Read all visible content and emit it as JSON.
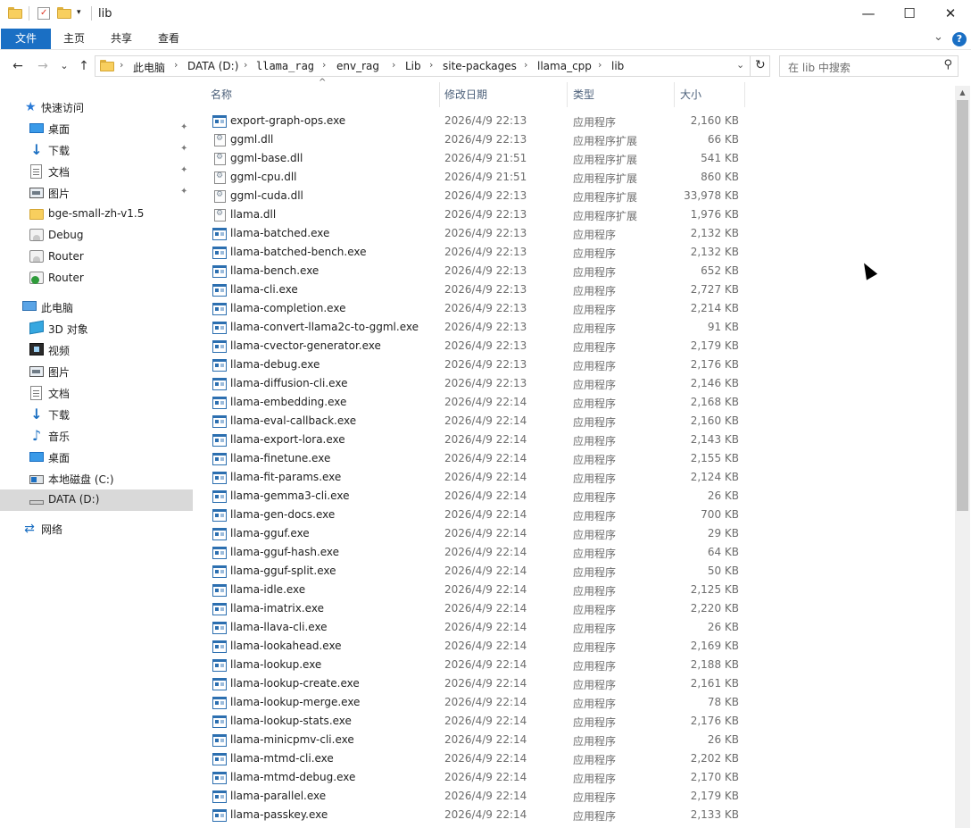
{
  "window": {
    "title": "lib",
    "minimize_glyph": "—",
    "maximize_glyph": "☐",
    "close_glyph": "✕"
  },
  "ribbon": {
    "tabs": [
      {
        "label": "文件"
      },
      {
        "label": "主页"
      },
      {
        "label": "共享"
      },
      {
        "label": "查看"
      }
    ],
    "expand_glyph": "⌄",
    "help_glyph": "?"
  },
  "nav": {
    "back_glyph": "←",
    "forward_glyph": "→",
    "recent_glyph": "⌄",
    "up_glyph": "↑",
    "dropdown_glyph": "⌄",
    "refresh_glyph": "↻"
  },
  "address": {
    "crumbs": [
      "此电脑",
      "DATA (D:)",
      "llama_rag",
      "env_rag",
      "Lib",
      "site-packages",
      "llama_cpp",
      "lib"
    ],
    "separator": "›"
  },
  "search": {
    "placeholder": "在 lib 中搜索",
    "icon": "search-icon"
  },
  "sidebar": {
    "quick_access": "快速访问",
    "quick_items": [
      {
        "label": "桌面",
        "icon": "desktop-icon",
        "pinned": true
      },
      {
        "label": "下载",
        "icon": "download-icon",
        "pinned": true
      },
      {
        "label": "文档",
        "icon": "documents-icon",
        "pinned": true
      },
      {
        "label": "图片",
        "icon": "pictures-icon",
        "pinned": true
      },
      {
        "label": "bge-small-zh-v1.5",
        "icon": "folder-icon",
        "pinned": false
      },
      {
        "label": "Debug",
        "icon": "drive-icon",
        "pinned": false
      },
      {
        "label": "Router",
        "icon": "drive-icon",
        "pinned": false
      },
      {
        "label": "Router",
        "icon": "drive-green-icon",
        "pinned": false
      }
    ],
    "this_pc": "此电脑",
    "pc_items": [
      {
        "label": "3D 对象",
        "icon": "3d-objects-icon"
      },
      {
        "label": "视频",
        "icon": "videos-icon"
      },
      {
        "label": "图片",
        "icon": "pictures-icon"
      },
      {
        "label": "文档",
        "icon": "documents-icon"
      },
      {
        "label": "下载",
        "icon": "download-icon"
      },
      {
        "label": "音乐",
        "icon": "music-icon"
      },
      {
        "label": "桌面",
        "icon": "desktop-icon"
      },
      {
        "label": "本地磁盘 (C:)",
        "icon": "local-disk-icon"
      },
      {
        "label": "DATA (D:)",
        "icon": "data-drive-icon",
        "selected": true
      }
    ],
    "network": "网络",
    "pin_glyph": "📌"
  },
  "columns": {
    "name": "名称",
    "date": "修改日期",
    "type": "类型",
    "size": "大小",
    "sort_glyph": "^"
  },
  "files": [
    {
      "name": "export-graph-ops.exe",
      "date": "2026/4/9 22:13",
      "type": "应用程序",
      "size": "2,160 KB",
      "kind": "exe"
    },
    {
      "name": "ggml.dll",
      "date": "2026/4/9 22:13",
      "type": "应用程序扩展",
      "size": "66 KB",
      "kind": "dll"
    },
    {
      "name": "ggml-base.dll",
      "date": "2026/4/9 21:51",
      "type": "应用程序扩展",
      "size": "541 KB",
      "kind": "dll"
    },
    {
      "name": "ggml-cpu.dll",
      "date": "2026/4/9 21:51",
      "type": "应用程序扩展",
      "size": "860 KB",
      "kind": "dll"
    },
    {
      "name": "ggml-cuda.dll",
      "date": "2026/4/9 22:13",
      "type": "应用程序扩展",
      "size": "33,978 KB",
      "kind": "dll"
    },
    {
      "name": "llama.dll",
      "date": "2026/4/9 22:13",
      "type": "应用程序扩展",
      "size": "1,976 KB",
      "kind": "dll"
    },
    {
      "name": "llama-batched.exe",
      "date": "2026/4/9 22:13",
      "type": "应用程序",
      "size": "2,132 KB",
      "kind": "exe"
    },
    {
      "name": "llama-batched-bench.exe",
      "date": "2026/4/9 22:13",
      "type": "应用程序",
      "size": "2,132 KB",
      "kind": "exe"
    },
    {
      "name": "llama-bench.exe",
      "date": "2026/4/9 22:13",
      "type": "应用程序",
      "size": "652 KB",
      "kind": "exe"
    },
    {
      "name": "llama-cli.exe",
      "date": "2026/4/9 22:13",
      "type": "应用程序",
      "size": "2,727 KB",
      "kind": "exe"
    },
    {
      "name": "llama-completion.exe",
      "date": "2026/4/9 22:13",
      "type": "应用程序",
      "size": "2,214 KB",
      "kind": "exe"
    },
    {
      "name": "llama-convert-llama2c-to-ggml.exe",
      "date": "2026/4/9 22:13",
      "type": "应用程序",
      "size": "91 KB",
      "kind": "exe"
    },
    {
      "name": "llama-cvector-generator.exe",
      "date": "2026/4/9 22:13",
      "type": "应用程序",
      "size": "2,179 KB",
      "kind": "exe"
    },
    {
      "name": "llama-debug.exe",
      "date": "2026/4/9 22:13",
      "type": "应用程序",
      "size": "2,176 KB",
      "kind": "exe"
    },
    {
      "name": "llama-diffusion-cli.exe",
      "date": "2026/4/9 22:13",
      "type": "应用程序",
      "size": "2,146 KB",
      "kind": "exe"
    },
    {
      "name": "llama-embedding.exe",
      "date": "2026/4/9 22:14",
      "type": "应用程序",
      "size": "2,168 KB",
      "kind": "exe"
    },
    {
      "name": "llama-eval-callback.exe",
      "date": "2026/4/9 22:14",
      "type": "应用程序",
      "size": "2,160 KB",
      "kind": "exe"
    },
    {
      "name": "llama-export-lora.exe",
      "date": "2026/4/9 22:14",
      "type": "应用程序",
      "size": "2,143 KB",
      "kind": "exe"
    },
    {
      "name": "llama-finetune.exe",
      "date": "2026/4/9 22:14",
      "type": "应用程序",
      "size": "2,155 KB",
      "kind": "exe"
    },
    {
      "name": "llama-fit-params.exe",
      "date": "2026/4/9 22:14",
      "type": "应用程序",
      "size": "2,124 KB",
      "kind": "exe"
    },
    {
      "name": "llama-gemma3-cli.exe",
      "date": "2026/4/9 22:14",
      "type": "应用程序",
      "size": "26 KB",
      "kind": "exe"
    },
    {
      "name": "llama-gen-docs.exe",
      "date": "2026/4/9 22:14",
      "type": "应用程序",
      "size": "700 KB",
      "kind": "exe"
    },
    {
      "name": "llama-gguf.exe",
      "date": "2026/4/9 22:14",
      "type": "应用程序",
      "size": "29 KB",
      "kind": "exe"
    },
    {
      "name": "llama-gguf-hash.exe",
      "date": "2026/4/9 22:14",
      "type": "应用程序",
      "size": "64 KB",
      "kind": "exe"
    },
    {
      "name": "llama-gguf-split.exe",
      "date": "2026/4/9 22:14",
      "type": "应用程序",
      "size": "50 KB",
      "kind": "exe"
    },
    {
      "name": "llama-idle.exe",
      "date": "2026/4/9 22:14",
      "type": "应用程序",
      "size": "2,125 KB",
      "kind": "exe"
    },
    {
      "name": "llama-imatrix.exe",
      "date": "2026/4/9 22:14",
      "type": "应用程序",
      "size": "2,220 KB",
      "kind": "exe"
    },
    {
      "name": "llama-llava-cli.exe",
      "date": "2026/4/9 22:14",
      "type": "应用程序",
      "size": "26 KB",
      "kind": "exe"
    },
    {
      "name": "llama-lookahead.exe",
      "date": "2026/4/9 22:14",
      "type": "应用程序",
      "size": "2,169 KB",
      "kind": "exe"
    },
    {
      "name": "llama-lookup.exe",
      "date": "2026/4/9 22:14",
      "type": "应用程序",
      "size": "2,188 KB",
      "kind": "exe"
    },
    {
      "name": "llama-lookup-create.exe",
      "date": "2026/4/9 22:14",
      "type": "应用程序",
      "size": "2,161 KB",
      "kind": "exe"
    },
    {
      "name": "llama-lookup-merge.exe",
      "date": "2026/4/9 22:14",
      "type": "应用程序",
      "size": "78 KB",
      "kind": "exe"
    },
    {
      "name": "llama-lookup-stats.exe",
      "date": "2026/4/9 22:14",
      "type": "应用程序",
      "size": "2,176 KB",
      "kind": "exe"
    },
    {
      "name": "llama-minicpmv-cli.exe",
      "date": "2026/4/9 22:14",
      "type": "应用程序",
      "size": "26 KB",
      "kind": "exe"
    },
    {
      "name": "llama-mtmd-cli.exe",
      "date": "2026/4/9 22:14",
      "type": "应用程序",
      "size": "2,202 KB",
      "kind": "exe"
    },
    {
      "name": "llama-mtmd-debug.exe",
      "date": "2026/4/9 22:14",
      "type": "应用程序",
      "size": "2,170 KB",
      "kind": "exe"
    },
    {
      "name": "llama-parallel.exe",
      "date": "2026/4/9 22:14",
      "type": "应用程序",
      "size": "2,179 KB",
      "kind": "exe"
    },
    {
      "name": "llama-passkey.exe",
      "date": "2026/4/9 22:14",
      "type": "应用程序",
      "size": "2,133 KB",
      "kind": "exe"
    }
  ],
  "colors": {
    "accent": "#1a6fc4",
    "selected_bg": "#d9d9d9",
    "header_text": "#4c607a"
  }
}
